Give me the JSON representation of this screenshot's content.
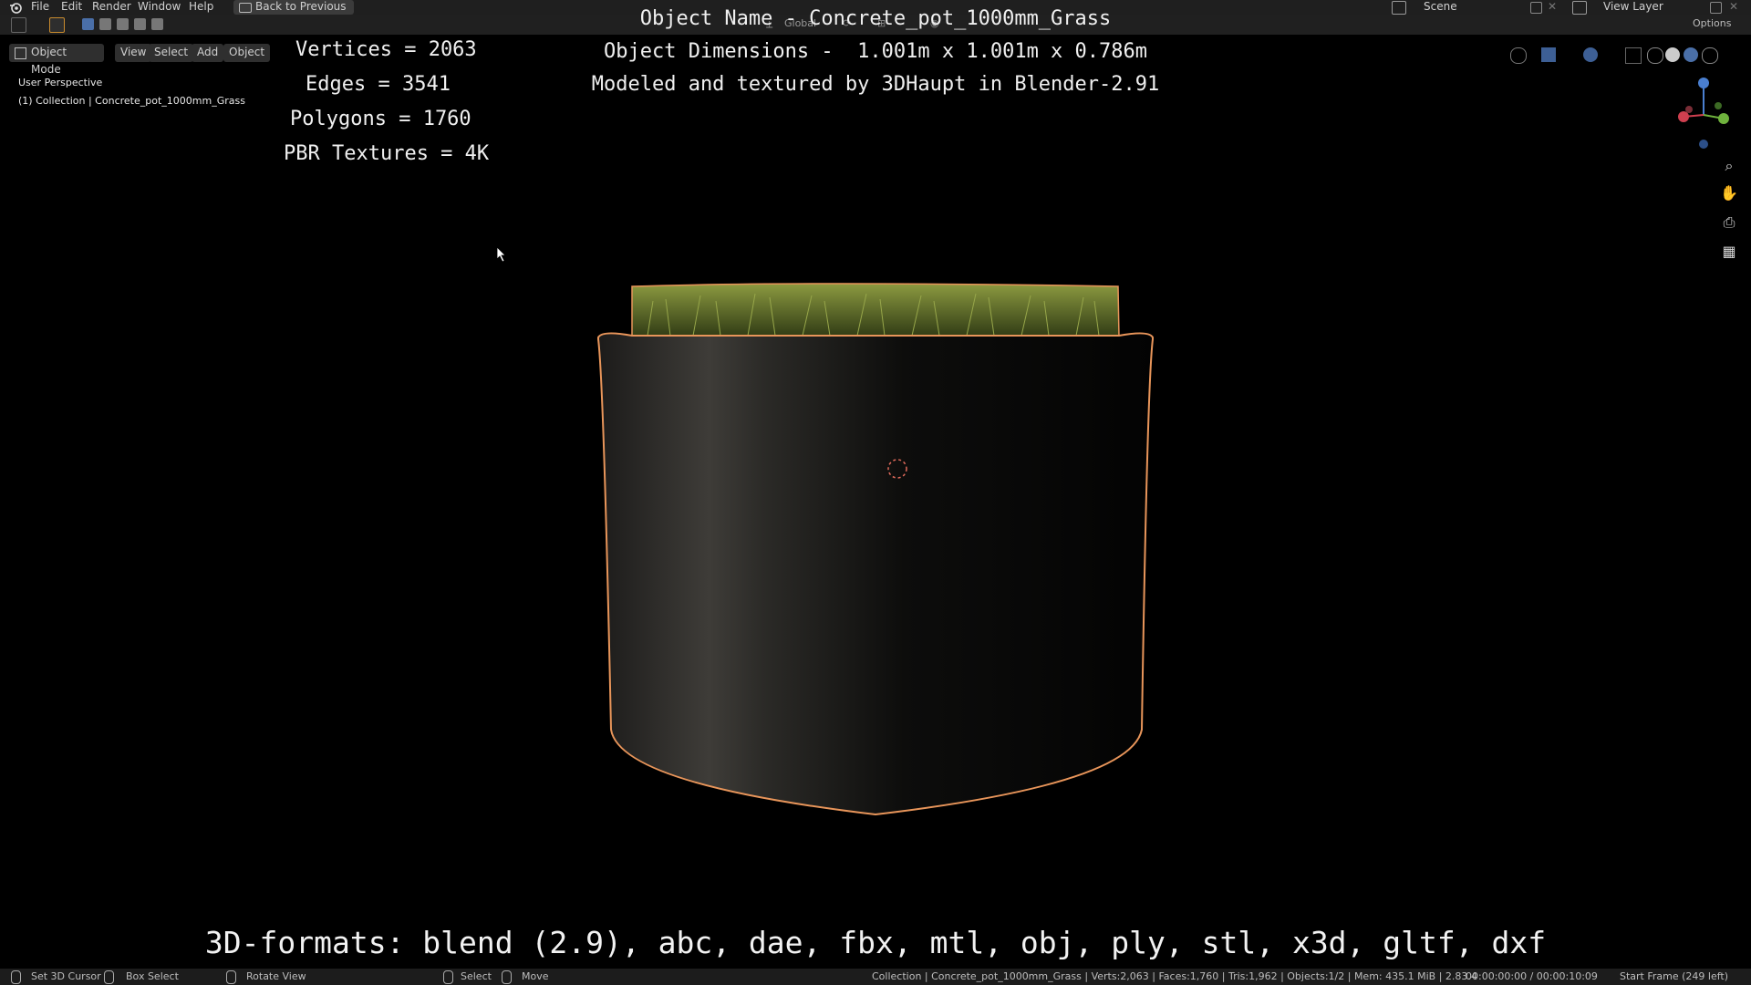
{
  "menu": {
    "items": [
      "File",
      "Edit",
      "Render",
      "Window",
      "Help"
    ],
    "back_button": "Back to Previous",
    "scene_label": "Scene",
    "view_layer_label": "View Layer"
  },
  "toolbar": {
    "orientation": "Global",
    "options": "Options"
  },
  "header": {
    "mode": "Object Mode",
    "view": "View",
    "select": "Select",
    "add": "Add",
    "object": "Object"
  },
  "viewport": {
    "perspective": "User Perspective",
    "collection": "(1) Collection | Concrete_pot_1000mm_Grass"
  },
  "overlay": {
    "vertices": "Vertices = 2063",
    "edges": "Edges = 3541",
    "polygons": "Polygons = 1760",
    "textures": "PBR Textures = 4K",
    "object_name": "Object Name - Concrete_pot_1000mm_Grass",
    "dimensions": "Object Dimensions -  1.001m x 1.001m x 0.786m",
    "credits": "Modeled and textured by 3DHaupt in Blender-2.91",
    "formats": "3D-formats: blend (2.9), abc, dae, fbx, mtl, obj, ply, stl, x3d, gltf, dxf"
  },
  "statusbar": {
    "set_cursor": "Set 3D Cursor",
    "box_select": "Box Select",
    "rotate_view": "Rotate View",
    "select": "Select",
    "move": "Move",
    "stats": "Collection | Concrete_pot_1000mm_Grass | Verts:2,063 | Faces:1,760 | Tris:1,962 | Objects:1/2 | Mem: 435.1 MiB | 2.83.4",
    "time": "00:00:00:00 / 00:00:10:09",
    "start_frame": "Start Frame (249 left)"
  },
  "colors": {
    "selection_outline": "#e8955a",
    "pot_dark": "#0f0f0f",
    "pot_light": "#3a3835",
    "grass": "#6b7a2a"
  }
}
